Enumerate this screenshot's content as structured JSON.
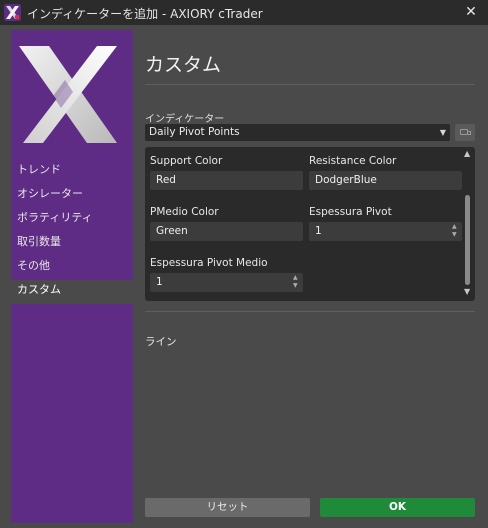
{
  "window": {
    "title": "インディケーターを追加 - AXIORY cTrader",
    "close_glyph": "✕",
    "app_icon": "ctrader-x-icon"
  },
  "sidebar": {
    "items": [
      {
        "label": "トレンド",
        "active": false
      },
      {
        "label": "オシレーター",
        "active": false
      },
      {
        "label": "ボラティリティ",
        "active": false
      },
      {
        "label": "取引数量",
        "active": false
      },
      {
        "label": "その他",
        "active": false
      },
      {
        "label": "カスタム",
        "active": true
      }
    ]
  },
  "main": {
    "title": "カスタム",
    "indicator_label": "インディケーター",
    "indicator_value": "Daily Pivot Points",
    "params": {
      "support_color": {
        "label": "Support Color",
        "value": "Red"
      },
      "resistance_color": {
        "label": "Resistance Color",
        "value": "DodgerBlue"
      },
      "pmedio_color": {
        "label": "PMedio Color",
        "value": "Green"
      },
      "espessura_pivot": {
        "label": "Espessura Pivot",
        "value": "1"
      },
      "espessura_pivot_medio": {
        "label": "Espessura Pivot Medio",
        "value": "1"
      }
    },
    "line_label": "ライン"
  },
  "buttons": {
    "reset": "リセット",
    "ok": "OK"
  },
  "colors": {
    "sidebar": "#5e2b85",
    "ok": "#1f8a3a",
    "background": "#4a4a4a",
    "panel": "#2a2a2a"
  }
}
